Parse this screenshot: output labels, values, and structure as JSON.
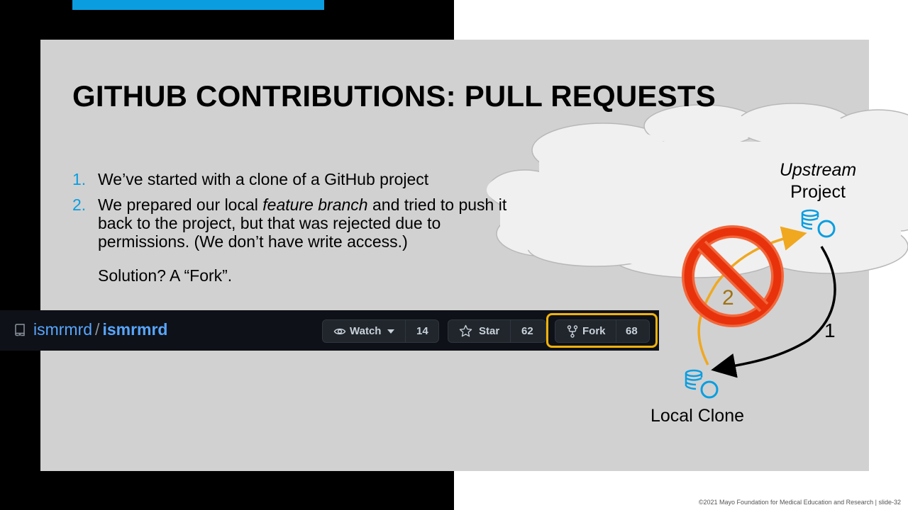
{
  "slide": {
    "title": "GITHUB CONTRIBUTIONS: PULL REQUESTS",
    "footer": "©2021 Mayo Foundation for Medical Education and Research  |  slide-32"
  },
  "bullets": [
    {
      "number": "1.",
      "text": "We’ve started with a clone of a GitHub project"
    },
    {
      "number": "2.",
      "text_before": "We prepared our local ",
      "emphasis": "feature branch",
      "text_after": " and tried to push it back to the project, but that was rejected due to permissions. (We don’t have write access.)"
    }
  ],
  "solution": "Solution? A “Fork”.",
  "github": {
    "owner": "ismrmrd",
    "separator": "/",
    "repo": "ismrmrd",
    "watch_label": "Watch",
    "watch_count": "14",
    "star_label": "Star",
    "star_count": "62",
    "fork_label": "Fork",
    "fork_count": "68"
  },
  "diagram": {
    "upstream_line1": "Upstream",
    "upstream_line2": "Project",
    "local_label": "Local Clone",
    "step1": "1",
    "step2": "2"
  },
  "colors": {
    "accent_blue": "#0a9ee0",
    "github_link": "#58a6ff",
    "highlight": "#f2b20c",
    "prohibit_red": "#ec3b12",
    "arrow_orange": "#f0a820"
  },
  "icons": [
    "repo-icon",
    "eye-icon",
    "caret-down-icon",
    "star-icon",
    "fork-icon",
    "database-icon",
    "no-entry-icon"
  ]
}
